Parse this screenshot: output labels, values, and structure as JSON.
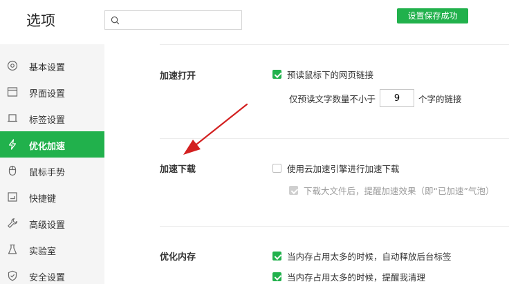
{
  "header": {
    "title": "选项",
    "search_value": "",
    "search_placeholder": "",
    "save_status": "设置保存成功"
  },
  "sidebar": {
    "items": [
      {
        "label": "基本设置",
        "icon": "gear-icon"
      },
      {
        "label": "界面设置",
        "icon": "window-icon"
      },
      {
        "label": "标签设置",
        "icon": "tab-icon"
      },
      {
        "label": "优化加速",
        "icon": "lightning-icon",
        "active": true
      },
      {
        "label": "鼠标手势",
        "icon": "mouse-icon"
      },
      {
        "label": "快捷键",
        "icon": "keyboard-icon"
      },
      {
        "label": "高级设置",
        "icon": "wrench-icon"
      },
      {
        "label": "实验室",
        "icon": "flask-icon"
      },
      {
        "label": "安全设置",
        "icon": "shield-icon"
      }
    ]
  },
  "sections": {
    "accelerate_open": {
      "title": "加速打开",
      "prefetch_label": "预读鼠标下的网页链接",
      "prefetch_checked": true,
      "min_chars_prefix": "仅预读文字数量不小于",
      "min_chars_value": "9",
      "min_chars_suffix": "个字的链接"
    },
    "accelerate_download": {
      "title": "加速下载",
      "cloud_label": "使用云加速引擎进行加速下载",
      "cloud_checked": false,
      "remind_label": "下载大文件后，提醒加速效果（即“已加速”气泡）",
      "remind_checked": true,
      "remind_disabled": true
    },
    "optimize_memory": {
      "title": "优化内存",
      "auto_release_label": "当内存占用太多的时候，自动释放后台标签",
      "auto_release_checked": true,
      "remind_clean_label": "当内存占用太多的时候，提醒我清理",
      "remind_clean_checked": true
    }
  },
  "colors": {
    "accent": "#21b14c",
    "arrow": "#d32020"
  }
}
